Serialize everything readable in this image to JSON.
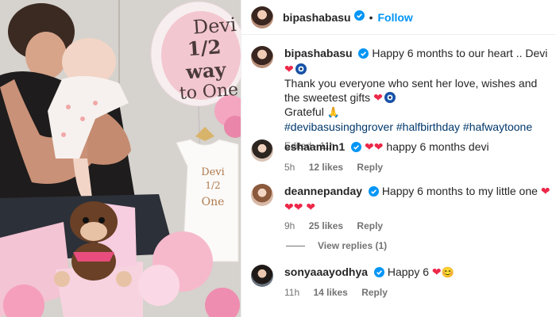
{
  "photo": {
    "balloon_line1": "Devi",
    "balloon_line2": "1/2 way",
    "balloon_line3": "to One",
    "onesie_line1": "Devi",
    "onesie_line2": "1/2",
    "onesie_line3": "One"
  },
  "header": {
    "username": "bipashabasu",
    "separator": "•",
    "follow_label": "Follow"
  },
  "caption": {
    "username": "bipashabasu",
    "line1": "Happy 6 months to our heart .. Devi",
    "line2": "Thank you everyone who sent her love, wishes and the sweetest gifts",
    "line3": "Grateful",
    "hashtags": "#devibasusinghgrover #halfbirthday #hafwaytoone",
    "meta": "Edited · 11h"
  },
  "comments": [
    {
      "username": "eshaamiin1",
      "text": "happy 6 months devi",
      "time": "5h",
      "likes": "12 likes",
      "reply": "Reply"
    },
    {
      "username": "deannepanday",
      "text": "Happy 6 months to my little one",
      "time": "9h",
      "likes": "25 likes",
      "reply": "Reply"
    },
    {
      "username": "sonyaaayodhya",
      "text": "Happy 6",
      "time": "11h",
      "likes": "14 likes",
      "reply": "Reply"
    }
  ],
  "view_replies": "View replies (1)",
  "icons": {
    "verified": "verified-badge-icon",
    "heart": "red-heart-icon",
    "evil_eye": "nazar-amulet-icon",
    "hands": "folded-hands-icon",
    "smile": "smiling-face-icon"
  },
  "colors": {
    "accent": "#0095f6",
    "hashtag": "#00376b",
    "muted": "#737373",
    "heart": "#ed2849"
  }
}
